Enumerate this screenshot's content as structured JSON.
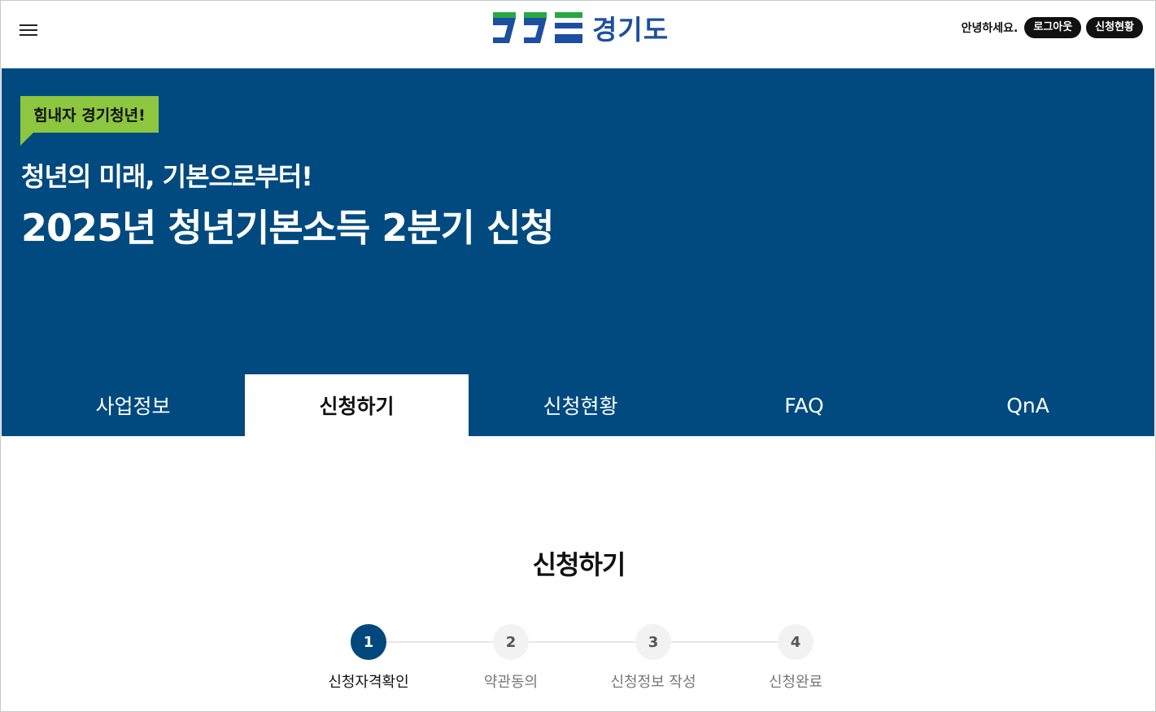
{
  "header": {
    "logo_text": "경기도",
    "greeting": "안녕하세요.",
    "logout_label": "로그아웃",
    "status_label": "신청현황"
  },
  "hero": {
    "badge": "힘내자 경기청년!",
    "subtitle": "청년의 미래, 기본으로부터!",
    "title": "2025년 청년기본소득 2분기 신청"
  },
  "tabs": [
    {
      "label": "사업정보"
    },
    {
      "label": "신청하기"
    },
    {
      "label": "신청현황"
    },
    {
      "label": "FAQ"
    },
    {
      "label": "QnA"
    }
  ],
  "active_tab": "신청하기",
  "main": {
    "title": "신청하기",
    "steps": [
      {
        "number": "1",
        "label": "신청자격확인"
      },
      {
        "number": "2",
        "label": "약관동의"
      },
      {
        "number": "3",
        "label": "신청정보 작성"
      },
      {
        "number": "4",
        "label": "신청완료"
      }
    ],
    "current_step": "1"
  },
  "colors": {
    "primary_blue": "#004a80",
    "badge_green": "#8dc63f",
    "logo_blue": "#1d4fa0",
    "logo_green": "#27a844"
  }
}
